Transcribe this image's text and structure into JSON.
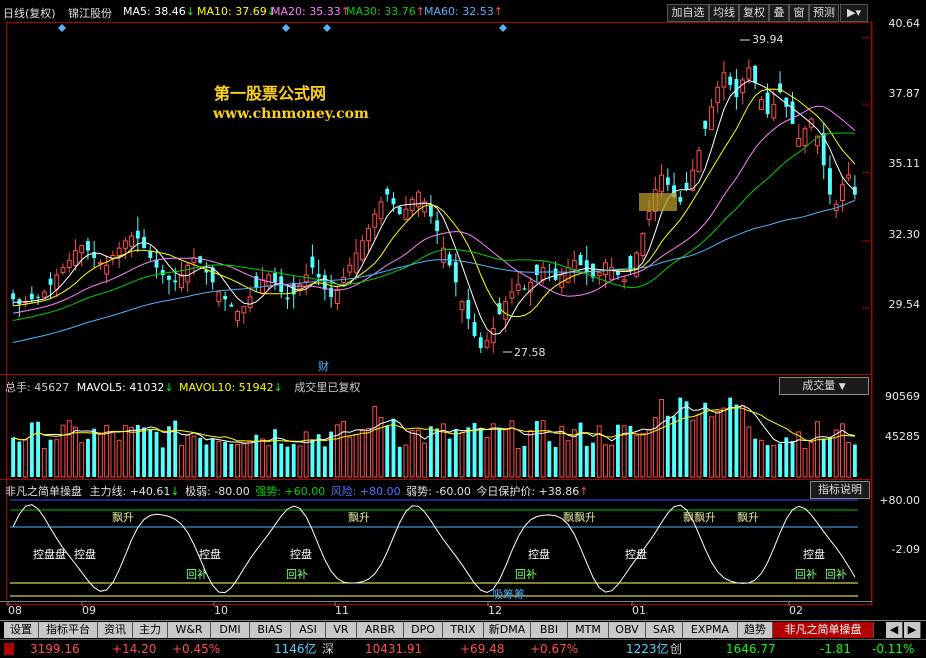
{
  "colors": {
    "up": "#ff4d4d",
    "down": "#54ffff",
    "ma5": "#ffffff",
    "ma10": "#ffff00",
    "ma20": "#ff80ff",
    "ma30": "#00d000",
    "ma60": "#4fb3ff"
  },
  "header": {
    "period": "日线(复权)",
    "stock": "锦江股份",
    "ma5": "MA5: 38.46",
    "ma10": "MA10: 37.69",
    "ma20": "MA20: 35.33",
    "ma30": "MA30: 33.76",
    "ma60": "MA60: 32.53",
    "buttons": [
      "加自选",
      "均线",
      "复权",
      "叠",
      "窗",
      "预测"
    ]
  },
  "watermark": {
    "title": "第一股票公式网",
    "url": "www.chnmoney.com"
  },
  "price_axis": [
    "40.64",
    "37.87",
    "35.11",
    "32.30",
    "29.54"
  ],
  "annotations": {
    "high": "39.94",
    "low": "27.58",
    "cai": "财"
  },
  "volume": {
    "total": "总手: 45627",
    "mavol5": "MAVOL5: 41032",
    "mavol10": "MAVOL10: 51942",
    "note": "成交里已复权",
    "select": "成交量",
    "axis": [
      "90569",
      "45285"
    ]
  },
  "indicator": {
    "name": "非凡之简单操盘",
    "line1": "主力线: +40.61",
    "weak": "极弱: -80.00",
    "strong": "强势: +60.00",
    "risk": "风险: +80.00",
    "weakness": "弱势: -60.00",
    "protect": "今日保护价: +38.86",
    "help": "指标说明",
    "axis": [
      "+80.00",
      "-2.09"
    ],
    "labels": {
      "piaosheng": "飘升",
      "piaopiaosheng": "飘飘升",
      "kongpan": "控盘",
      "kongpankongpan": "控盘盘",
      "huibu": "回补",
      "xichou": "吸筹筹"
    }
  },
  "months": [
    "08",
    "09",
    "10",
    "11",
    "12",
    "01",
    "02"
  ],
  "tabs": [
    "设置",
    "指标平台",
    "资讯",
    "主力",
    "W&R",
    "DMI",
    "BIAS",
    "ASI",
    "VR",
    "ARBR",
    "DPO",
    "TRIX",
    "新DMA",
    "BBI",
    "MTM",
    "OBV",
    "SAR",
    "EXPMA",
    "趋势",
    "非凡之简单操盘"
  ],
  "status": {
    "sh_index": "3199.16",
    "sh_change": "+14.20",
    "sh_pct": "+0.45%",
    "sh_amount": "1146亿",
    "sz_label": "深",
    "sz_index": "10431.91",
    "sz_change": "+69.48",
    "sz_pct": "+0.67%",
    "cy_amount": "1223亿",
    "cy_label": "创",
    "cy_index": "1646.77",
    "cy_change": "-1.81",
    "cy_pct": "-0.11%"
  },
  "chart_data": {
    "type": "candlestick",
    "price_range": [
      27.0,
      41.2
    ],
    "high_label": 39.94,
    "low_label": 27.58,
    "closes": [
      29.9,
      29.7,
      29.8,
      29.9,
      30.0,
      30.2,
      30.5,
      30.9,
      31.2,
      31.5,
      31.9,
      32.1,
      31.9,
      31.6,
      31.4,
      31.3,
      31.7,
      32.0,
      32.3,
      32.5,
      32.4,
      32.0,
      31.6,
      31.2,
      30.9,
      30.7,
      30.6,
      30.9,
      31.3,
      31.6,
      31.4,
      31.0,
      30.6,
      30.2,
      29.9,
      29.6,
      29.4,
      29.6,
      30.0,
      30.4,
      30.7,
      30.9,
      30.6,
      30.2,
      29.9,
      30.1,
      30.5,
      30.9,
      31.2,
      30.8,
      30.3,
      30.0,
      30.3,
      30.8,
      31.3,
      31.8,
      32.3,
      32.8,
      33.4,
      33.9,
      34.2,
      33.8,
      33.4,
      33.6,
      34.0,
      34.3,
      33.9,
      33.3,
      32.7,
      32.0,
      31.3,
      30.6,
      29.8,
      29.1,
      28.4,
      27.9,
      28.2,
      28.7,
      29.3,
      29.8,
      30.2,
      30.5,
      30.3,
      30.6,
      30.9,
      31.2,
      31.0,
      30.7,
      30.9,
      31.2,
      31.5,
      31.3,
      31.0,
      30.8,
      31.0,
      31.4,
      31.2,
      30.9,
      30.7,
      31.1,
      31.8,
      32.6,
      33.5,
      34.4,
      35.0,
      34.6,
      34.1,
      33.9,
      34.4,
      35.2,
      36.0,
      36.9,
      37.8,
      38.6,
      39.2,
      38.7,
      38.2,
      38.9,
      39.4,
      38.8,
      38.1,
      37.5,
      37.9,
      38.4,
      37.8,
      37.1,
      36.5,
      36.9,
      37.3,
      36.6,
      35.4,
      34.2,
      33.8,
      34.6,
      35.0,
      34.2
    ]
  }
}
